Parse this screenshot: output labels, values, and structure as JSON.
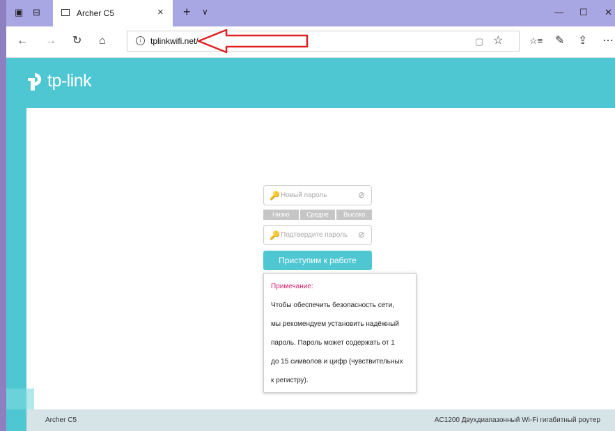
{
  "browser": {
    "tab_title": "Archer C5",
    "tab_close": "×",
    "new_tab": "+",
    "tab_menu": "∨",
    "win_min": "—",
    "win_max": "☐",
    "win_close": "✕",
    "nav_back": "←",
    "nav_forward": "→",
    "nav_refresh": "↻",
    "nav_home": "⌂",
    "url": "tplinkwifi.net/",
    "info_icon": "i",
    "reading_icon": "▢",
    "favorite_icon": "☆",
    "favorites_hub_icon": "☆≡",
    "notes_icon": "✎",
    "share_icon": "⇪",
    "more_icon": "⋯",
    "accent_arrow_color": "#e02020"
  },
  "brand": {
    "logo_text": "tp-link",
    "color": "#4ec7d3"
  },
  "form": {
    "new_password_placeholder": "Новый пароль",
    "confirm_password_placeholder": "Подтвердите пароль",
    "strength": [
      "Низко",
      "Средне",
      "Высоко"
    ],
    "submit_label": "Приступим к работе",
    "key_icon": "🔑",
    "eye_icon": "⊘"
  },
  "note": {
    "title": "Примечание:",
    "lines": [
      "Чтобы обеспечить безопасность сети,",
      "мы рекомендуем установить надёжный",
      "пароль. Пароль может содержать от 1",
      "до 15 символов и цифр (чувствительных",
      "к регистру)."
    ]
  },
  "footer": {
    "model": "Archer C5",
    "description": "AC1200 Двухдиапазонный Wi-Fi гигабитный роутер"
  }
}
